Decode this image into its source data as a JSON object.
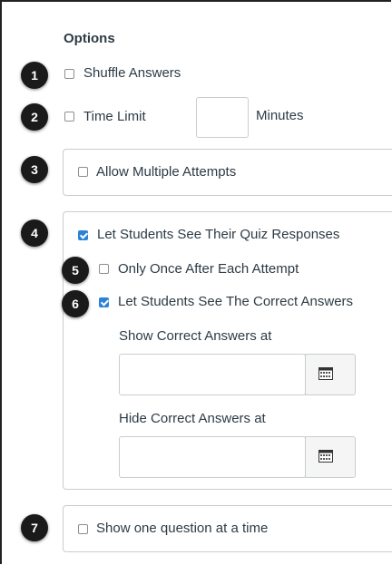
{
  "options": {
    "heading": "Options",
    "shuffle_answers": {
      "label": "Shuffle Answers",
      "checked": false,
      "badge": "1"
    },
    "time_limit": {
      "label": "Time Limit",
      "checked": false,
      "badge": "2",
      "value": "",
      "unit": "Minutes"
    },
    "multiple_attempts": {
      "label": "Allow Multiple Attempts",
      "checked": false,
      "badge": "3"
    },
    "see_responses": {
      "label": "Let Students See Their Quiz Responses",
      "checked": true,
      "badge": "4"
    },
    "only_once": {
      "label": "Only Once After Each Attempt",
      "checked": false,
      "badge": "5"
    },
    "see_correct": {
      "label": "Let Students See The Correct Answers",
      "checked": true,
      "badge": "6"
    },
    "show_correct_at": {
      "label": "Show Correct Answers at",
      "value": ""
    },
    "hide_correct_at": {
      "label": "Hide Correct Answers at",
      "value": ""
    },
    "one_question": {
      "label": "Show one question at a time",
      "checked": false,
      "badge": "7"
    }
  },
  "icons": {
    "calendar": "calendar-icon"
  },
  "colors": {
    "checkbox_checked": "#2a83d6",
    "badge": "#1a1a1a",
    "text": "#2d3b45"
  }
}
